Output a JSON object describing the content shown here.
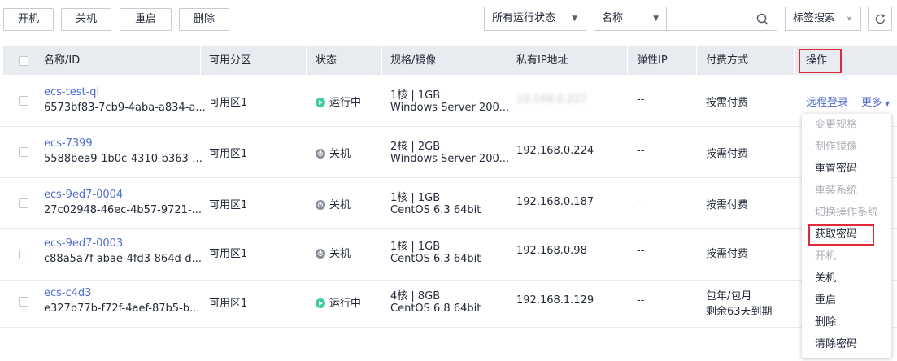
{
  "toolbar": {
    "start": "开机",
    "stop": "关机",
    "restart": "重启",
    "delete": "删除",
    "status_filter": "所有运行状态",
    "search_field": "名称",
    "search_value": "",
    "tag_search": "标签搜索"
  },
  "table": {
    "headers": {
      "name": "名称/ID",
      "zone": "可用分区",
      "status": "状态",
      "spec": "规格/镜像",
      "private_ip": "私有IP地址",
      "eip": "弹性IP",
      "billing": "付费方式",
      "action": "操作"
    },
    "rows": [
      {
        "name": "ecs-test-ql",
        "id": "6573bf83-7cb9-4aba-a834-a...",
        "zone": "可用区1",
        "status": "运行中",
        "status_type": "running",
        "spec": "1核 | 1GB",
        "image": "Windows Server 200...",
        "ip": "10.168.0.227",
        "eip": "--",
        "billing": "按需付费",
        "billing2": ""
      },
      {
        "name": "ecs-7399",
        "id": "5588bea9-1b0c-4310-b363-...",
        "zone": "可用区1",
        "status": "关机",
        "status_type": "stopped",
        "spec": "2核 | 2GB",
        "image": "Windows Server 200...",
        "ip": "192.168.0.224",
        "eip": "--",
        "billing": "按需付费",
        "billing2": ""
      },
      {
        "name": "ecs-9ed7-0004",
        "id": "27c02948-46ec-4b57-9721-...",
        "zone": "可用区1",
        "status": "关机",
        "status_type": "stopped",
        "spec": "1核 | 1GB",
        "image": "CentOS 6.3 64bit",
        "ip": "192.168.0.187",
        "eip": "--",
        "billing": "按需付费",
        "billing2": ""
      },
      {
        "name": "ecs-9ed7-0003",
        "id": "c88a5a7f-abae-4fd3-864d-d...",
        "zone": "可用区1",
        "status": "关机",
        "status_type": "stopped",
        "spec": "1核 | 1GB",
        "image": "CentOS 6.3 64bit",
        "ip": "192.168.0.98",
        "eip": "--",
        "billing": "按需付费",
        "billing2": ""
      },
      {
        "name": "ecs-c4d3",
        "id": "e327b77b-f72f-4aef-87b5-b...",
        "zone": "可用区1",
        "status": "运行中",
        "status_type": "running",
        "spec": "4核 | 8GB",
        "image": "CentOS 6.8 64bit",
        "ip": "192.168.1.129",
        "eip": "--",
        "billing": "包年/包月",
        "billing2": "剩余63天到期"
      }
    ]
  },
  "row_actions": {
    "remote_login": "远程登录",
    "more": "更多"
  },
  "more_menu": [
    {
      "label": "变更规格",
      "enabled": false
    },
    {
      "label": "制作镜像",
      "enabled": false
    },
    {
      "label": "重置密码",
      "enabled": true
    },
    {
      "label": "重装系统",
      "enabled": false
    },
    {
      "label": "切换操作系统",
      "enabled": false
    },
    {
      "label": "获取密码",
      "enabled": true
    },
    {
      "label": "开机",
      "enabled": false
    },
    {
      "label": "关机",
      "enabled": true
    },
    {
      "label": "重启",
      "enabled": true
    },
    {
      "label": "删除",
      "enabled": true
    },
    {
      "label": "清除密码",
      "enabled": true
    }
  ],
  "colors": {
    "link": "#526ecc",
    "running": "#3dcca6",
    "stopped": "#8a8e99",
    "highlight": "#e0293a",
    "header_bg": "#e8ebf0"
  }
}
